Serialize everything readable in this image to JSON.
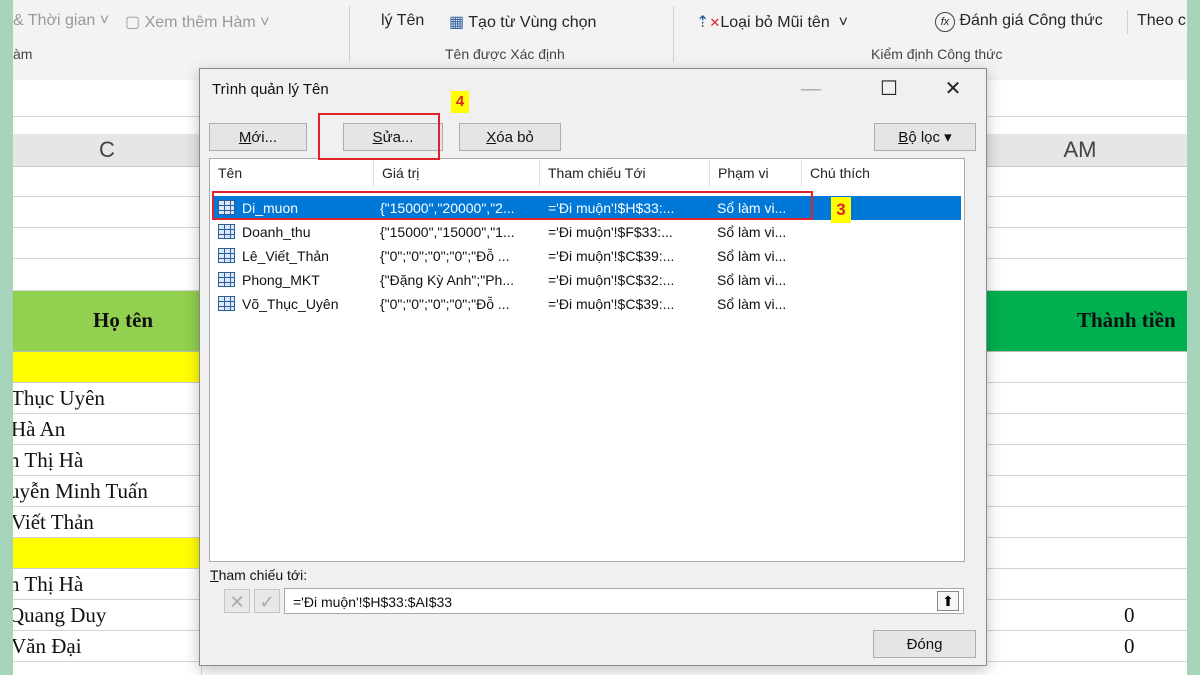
{
  "ribbon": {
    "item_time": "& Thời gian",
    "item_more": "Xem thêm Hàm",
    "group_left": "àm",
    "item_name": "lý Tên",
    "item_create": "Tạo từ Vùng chọn",
    "group_defined": "Tên được Xác định",
    "item_remove_arrows": "Loại bỏ Mũi tên",
    "item_evaluate": "Đánh giá Công thức",
    "item_watch": "Theo c",
    "group_audit": "Kiểm định Công thức",
    "fx_glyph": "fx"
  },
  "sheet": {
    "col_c": "C",
    "col_am": "AM",
    "header_name": "Họ tên",
    "header_total": "Thành tiền",
    "names": [
      "Thục Uyên",
      "Hà An",
      "n Thị Hà",
      "uyễn Minh Tuấn",
      "Viết Thản",
      "",
      "n Thị Hà",
      " Quang Duy",
      "Văn Đại"
    ],
    "zero_1": "0",
    "zero_2": "0"
  },
  "dialog": {
    "title": "Trình quản lý Tên",
    "minimize_glyph": "—",
    "maximize_glyph": "☐",
    "close_glyph": "✕",
    "btn_new_u": "M",
    "btn_new_rest": "ới...",
    "btn_edit_u": "S",
    "btn_edit_rest": "ửa...",
    "btn_delete_u": "X",
    "btn_delete_rest": "óa bỏ",
    "btn_filter_u": "B",
    "btn_filter_rest": "ộ lọc ▾",
    "columns": [
      "Tên",
      "Giá trị",
      "Tham chiếu Tới",
      "Phạm vi",
      "Chú thích"
    ],
    "rows": [
      {
        "name": "Di_muon",
        "value": "{\"15000\",\"20000\",\"2...",
        "ref": "='Đi muộn'!$H$33:...",
        "scope": "Sổ làm vi..."
      },
      {
        "name": "Doanh_thu",
        "value": "{\"15000\",\"15000\",\"1...",
        "ref": "='Đi muộn'!$F$33:...",
        "scope": "Sổ làm vi..."
      },
      {
        "name": "Lê_Viết_Thản",
        "value": "{\"0\";\"0\";\"0\";\"0\";\"Đỗ ...",
        "ref": "='Đi muộn'!$C$39:...",
        "scope": "Sổ làm vi..."
      },
      {
        "name": "Phong_MKT",
        "value": "{\"Đặng Kỳ Anh\";\"Ph...",
        "ref": "='Đi muộn'!$C$32:...",
        "scope": "Sổ làm vi..."
      },
      {
        "name": "Võ_Thục_Uyên",
        "value": "{\"0\";\"0\";\"0\";\"0\";\"Đỗ ...",
        "ref": "='Đi muộn'!$C$39:...",
        "scope": "Sổ làm vi..."
      }
    ],
    "ref_label_u": "T",
    "ref_label_rest": "ham chiếu tới:",
    "ref_value": "='Đi muộn'!$H$33:$AI$33",
    "cancel_glyph": "✕",
    "confirm_glyph": "✓",
    "collapse_glyph": "⬆",
    "close_button": "Đóng"
  },
  "annotations": {
    "step_3": "3",
    "step_4": "4",
    "color": "#e0222b"
  }
}
